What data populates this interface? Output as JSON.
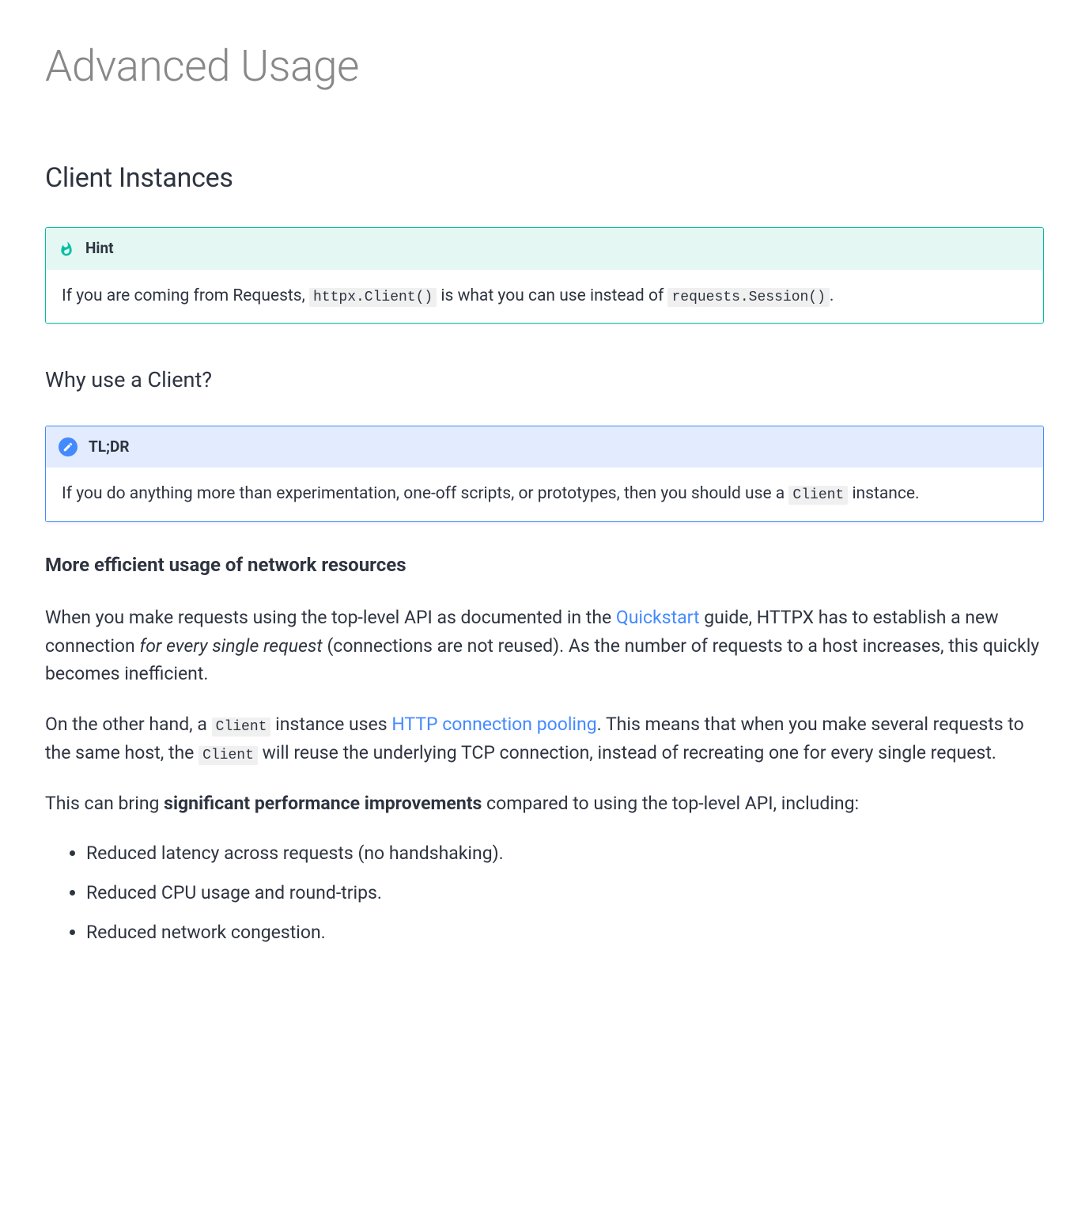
{
  "h1": "Advanced Usage",
  "h2": "Client Instances",
  "hint": {
    "title": "Hint",
    "body_before_code1": "If you are coming from Requests, ",
    "code1": "httpx.Client()",
    "body_mid": " is what you can use instead of ",
    "code2": "requests.Session()",
    "body_after": "."
  },
  "h3": "Why use a Client?",
  "note": {
    "title": "TL;DR",
    "body_before": "If you do anything more than experimentation, one-off scripts, or prototypes, then you should use a ",
    "code": "Client",
    "body_after": " instance."
  },
  "h4": "More efficient usage of network resources",
  "p1": {
    "t1": "When you make requests using the top-level API as documented in the ",
    "link": "Quickstart",
    "t2": " guide, HTTPX has to establish a new connection ",
    "em": "for every single request",
    "t3": " (connections are not reused). As the number of requests to a host increases, this quickly becomes inefficient."
  },
  "p2": {
    "t1": "On the other hand, a ",
    "code1": "Client",
    "t2": " instance uses ",
    "link": "HTTP connection pooling",
    "t3": ". This means that when you make several requests to the same host, the ",
    "code2": "Client",
    "t4": " will reuse the underlying TCP connection, instead of recreating one for every single request."
  },
  "p3": {
    "t1": "This can bring ",
    "strong": "significant performance improvements",
    "t2": " compared to using the top-level API, including:"
  },
  "list": [
    "Reduced latency across requests (no handshaking).",
    "Reduced CPU usage and round-trips.",
    "Reduced network congestion."
  ]
}
